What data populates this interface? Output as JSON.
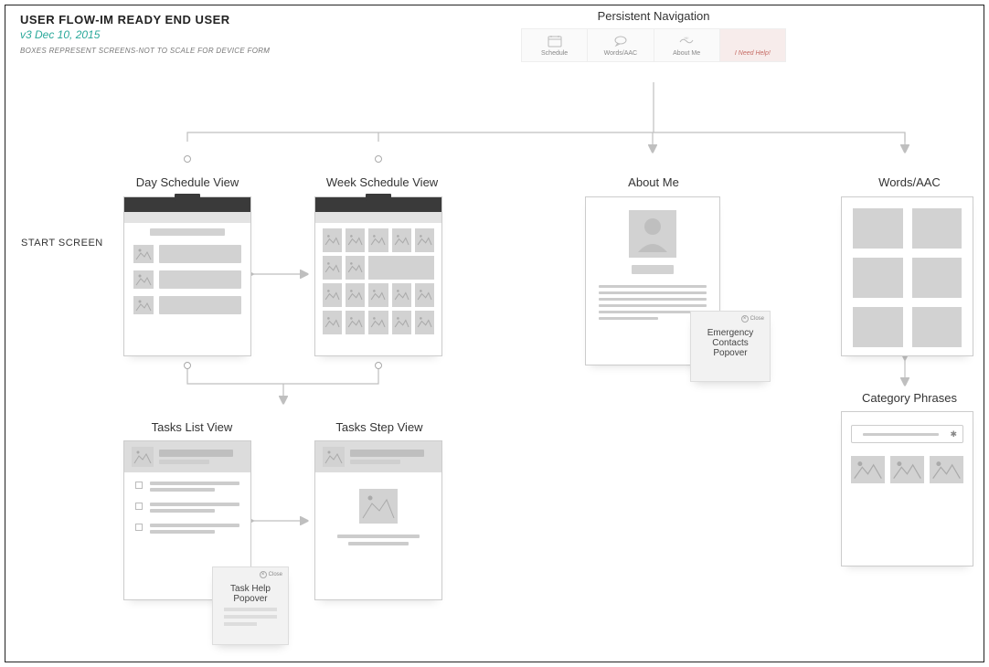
{
  "header": {
    "title": "USER FLOW-IM READY END USER",
    "subtitle": "v3 Dec 10, 2015",
    "note": "BOXES REPRESENT SCREENS-NOT TO SCALE FOR DEVICE FORM"
  },
  "persistent_nav": {
    "title": "Persistent Navigation",
    "items": [
      {
        "label": "Schedule"
      },
      {
        "label": "Words/AAC"
      },
      {
        "label": "About Me"
      },
      {
        "label": "I Need Help!"
      }
    ]
  },
  "side_label": "START SCREEN",
  "screens": {
    "day": "Day Schedule View",
    "week": "Week Schedule View",
    "about": "About Me",
    "words": "Words/AAC",
    "tasks_list": "Tasks List View",
    "tasks_step": "Tasks Step View",
    "category": "Category Phrases"
  },
  "popovers": {
    "emergency": {
      "title_l1": "Emergency",
      "title_l2": "Contacts",
      "title_l3": "Popover",
      "close": "Close"
    },
    "task_help": {
      "title_l1": "Task Help",
      "title_l2": "Popover",
      "close": "Close"
    }
  }
}
